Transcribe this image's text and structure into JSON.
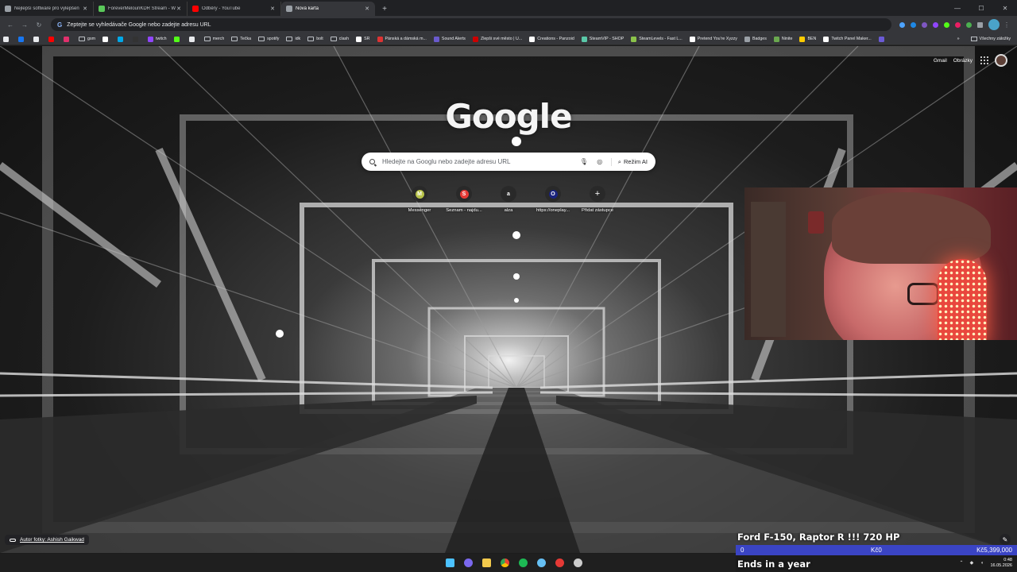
{
  "tabs": [
    {
      "title": "Nejlepší software pro vylepšen",
      "favicon_color": "#9aa0a6",
      "active": false
    },
    {
      "title": "ForeverMelounKDR Stream - W",
      "favicon_color": "#5ac85a",
      "active": false
    },
    {
      "title": "Odběry - YouTube",
      "favicon_color": "#ff0000",
      "active": false
    },
    {
      "title": "Nová karta",
      "favicon_color": "#9aa0a6",
      "active": true
    }
  ],
  "omnibox": {
    "placeholder": "Zeptejte se vyhledávače Google nebo zadejte adresu URL"
  },
  "bookmarks": [
    {
      "label": "",
      "color": "#e8eaed",
      "kind": "icon"
    },
    {
      "label": "",
      "color": "#1877f2",
      "kind": "icon"
    },
    {
      "label": "",
      "color": "#e8eaed",
      "kind": "icon"
    },
    {
      "label": "",
      "color": "#ff0000",
      "kind": "icon"
    },
    {
      "label": "",
      "color": "#e1306c",
      "kind": "icon"
    },
    {
      "label": "gsm",
      "color": "",
      "kind": "folder"
    },
    {
      "label": "",
      "color": "#ffffff",
      "kind": "icon"
    },
    {
      "label": "",
      "color": "#00a8e8",
      "kind": "icon"
    },
    {
      "label": "",
      "color": "#333333",
      "kind": "icon"
    },
    {
      "label": "twitch",
      "color": "#9146ff",
      "kind": "icon"
    },
    {
      "label": "",
      "color": "#53fc18",
      "kind": "icon"
    },
    {
      "label": "",
      "color": "#e8eaed",
      "kind": "icon"
    },
    {
      "label": "merch",
      "color": "",
      "kind": "folder"
    },
    {
      "label": "Tečka",
      "color": "",
      "kind": "folder"
    },
    {
      "label": "spotify",
      "color": "",
      "kind": "folder"
    },
    {
      "label": "idk",
      "color": "",
      "kind": "folder"
    },
    {
      "label": "bolt",
      "color": "",
      "kind": "folder"
    },
    {
      "label": "clash",
      "color": "",
      "kind": "folder"
    },
    {
      "label": "SR",
      "color": "#ffffff",
      "kind": "icon"
    },
    {
      "label": "Pánská a dámská m...",
      "color": "#d33",
      "kind": "icon"
    },
    {
      "label": "Sound Alerts",
      "color": "#6a5acd",
      "kind": "icon"
    },
    {
      "label": "Zlepši své město | U...",
      "color": "#cc0000",
      "kind": "icon"
    },
    {
      "label": "Creations - Panzoid",
      "color": "#ffffff",
      "kind": "icon"
    },
    {
      "label": "SteamVIP - SHOP",
      "color": "#5ac8a8",
      "kind": "icon"
    },
    {
      "label": "SteamLevels - Fast L...",
      "color": "#8bc34a",
      "kind": "icon"
    },
    {
      "label": "Pretend You're Xyzzy",
      "color": "#ffffff",
      "kind": "icon"
    },
    {
      "label": "Badges",
      "color": "#9aa0a6",
      "kind": "icon"
    },
    {
      "label": "Ninite",
      "color": "#6aa84f",
      "kind": "icon"
    },
    {
      "label": "BEN",
      "color": "#ffcc00",
      "kind": "icon"
    },
    {
      "label": "Twitch Panel Maker...",
      "color": "#ffffff",
      "kind": "icon"
    },
    {
      "label": "",
      "color": "#6b5bd6",
      "kind": "icon"
    }
  ],
  "all_bookmarks_label": "Všechny záložky",
  "top_links": {
    "gmail": "Gmail",
    "images": "Obrázky"
  },
  "logo_text": "Google",
  "search": {
    "placeholder": "Hledejte na Googlu nebo zadejte adresu URL",
    "ai_mode_label": "Režim AI"
  },
  "shortcuts": [
    {
      "label": "Messenger",
      "glyph": "M",
      "color": "#b8c34a"
    },
    {
      "label": "Seznam - najdu...",
      "glyph": "S",
      "color": "#e53935"
    },
    {
      "label": "alza",
      "glyph": "a",
      "color": "#2a2a2a"
    },
    {
      "label": "https://oneplay...",
      "glyph": "O",
      "color": "#1a237e"
    },
    {
      "label": "Přidat zástupce",
      "glyph": "+",
      "color": "transparent"
    }
  ],
  "photo_credit": "Autor fotky: Ashish Gaikwad",
  "alert": {
    "title": "Ford F-150, Raptor R !!! 720 HP",
    "left_value": "0",
    "mid_value": "Kč0",
    "right_value": "Kč5,399,000",
    "subtitle": "Ends in a year"
  },
  "taskbar_apps": [
    {
      "name": "start",
      "color": "#4cc2ff"
    },
    {
      "name": "chat",
      "color": "#7b68ee"
    },
    {
      "name": "explorer",
      "color": "#f2c94c"
    },
    {
      "name": "chrome",
      "color": "#34a853"
    },
    {
      "name": "spotify",
      "color": "#1db954"
    },
    {
      "name": "steam",
      "color": "#66c0f4"
    },
    {
      "name": "game",
      "color": "#e53935"
    },
    {
      "name": "ccleaner",
      "color": "#cccccc"
    }
  ],
  "clock": {
    "time": "0:48",
    "date": "16.05.2026"
  }
}
